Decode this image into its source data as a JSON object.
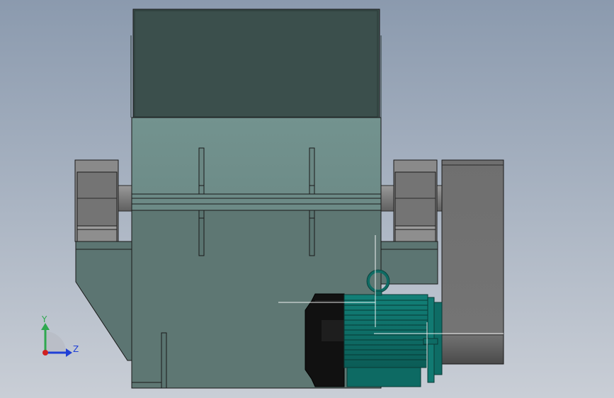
{
  "viewport": {
    "background_top": "#8b9aae",
    "background_bottom": "#c9ced6"
  },
  "model": {
    "hopper_color": "#3b4f4c",
    "body_color": "#5e7773",
    "body_highlight": "#73938f",
    "bearing_color": "#7a7a7a",
    "motor_color": "#0f6b63",
    "motor_end_color": "#111111",
    "guard_color": "#707070"
  },
  "triad": {
    "y_label": "Y",
    "z_label": "Z",
    "y_color": "#2fa84f",
    "z_color": "#1f3fd6",
    "x_color": "#d02020"
  }
}
